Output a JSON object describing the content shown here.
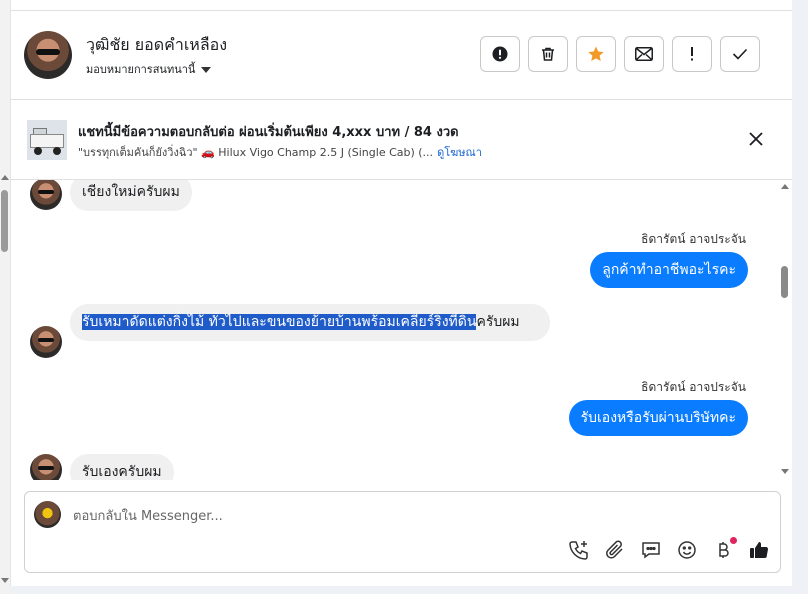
{
  "header": {
    "contact_name": "วุฒิชัย ยอดคำเหลือง",
    "assign_label": "มอบหมายการสนทนานี้"
  },
  "actions": [
    {
      "icon": "alert-circle-icon"
    },
    {
      "icon": "trash-icon"
    },
    {
      "icon": "star-icon",
      "color": "#f29a28"
    },
    {
      "icon": "mail-icon"
    },
    {
      "icon": "exclamation-icon"
    },
    {
      "icon": "check-icon"
    }
  ],
  "ad": {
    "title": "แชทนี้มีข้อความตอบกลับต่อ ผ่อนเริ่มต้นเพียง 4,xxx บาท / 84 งวด",
    "subtitle": "\"บรรทุกเต็มคันก็ยังวิ่งฉิว\" 🚗 Hilux Vigo Champ 2.5 J (Single Cab) (...",
    "link": "ดูโฆษณา"
  },
  "messages": [
    {
      "direction": "in",
      "text": "เชียงใหม่ครับผม"
    },
    {
      "direction": "out",
      "sender": "ธิดารัตน์ อาจประจัน",
      "text": "ลูกค้าทำอาชีพอะไรคะ"
    },
    {
      "direction": "in",
      "text_selected": "รับเหมาดัดแต่งกิ่งไม้ ทั่วไปและขนของย้ายบ้านพร้อมเคลียร์ริ่งที่ดิน",
      "text_rest": "ครับผม"
    },
    {
      "direction": "out",
      "sender": "ธิดารัตน์ อาจประจัน",
      "text": "รับเองหรือรับผ่านบริษัทคะ"
    },
    {
      "direction": "in",
      "text": "รับเองครับผม"
    }
  ],
  "composer": {
    "placeholder": "ตอบกลับใน Messenger..."
  },
  "colors": {
    "accent": "#0a7cff",
    "star": "#f29a28",
    "link": "#1763cf",
    "selection": "#1f5cc9"
  }
}
